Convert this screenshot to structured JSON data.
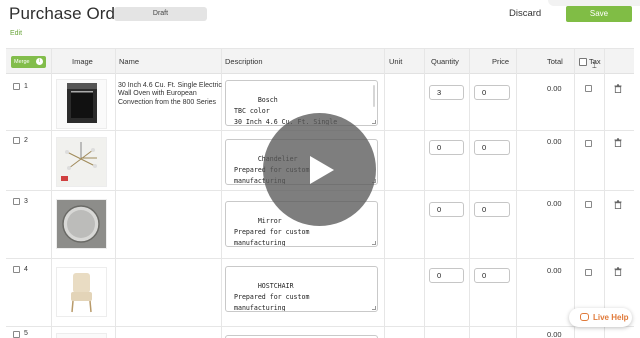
{
  "header": {
    "title": "Purchase Order",
    "status_badge": "Draft",
    "discard_label": "Discard",
    "save_label": "Save",
    "edit_label": "Edit"
  },
  "table": {
    "merge_label": "Merge",
    "merge_info": "i",
    "columns": {
      "image": "Image",
      "name": "Name",
      "description": "Description",
      "unit": "Unit",
      "quantity": "Quantity",
      "price": "Price",
      "total": "Total",
      "tax": "Tax"
    },
    "rows": [
      {
        "num": "1",
        "name": "30 Inch 4.6 Cu. Ft. Single Electric Wall Oven with European Convection from the 800 Series",
        "description": "Bosch\nTBC color\n30 Inch 4.6 Cu. Ft. Single",
        "quantity": "3",
        "price": "0",
        "total": "0.00",
        "image": "wall-oven"
      },
      {
        "num": "2",
        "name": "",
        "description": "Chandelier\nPrepared for custom\nmanufacturing",
        "quantity": "0",
        "price": "0",
        "total": "0.00",
        "image": "chandelier"
      },
      {
        "num": "3",
        "name": "",
        "description": "Mirror\nPrepared for custom\nmanufacturing",
        "quantity": "0",
        "price": "0",
        "total": "0.00",
        "image": "round-mirror"
      },
      {
        "num": "4",
        "name": "",
        "description": "HOSTCHAIR\nPrepared for custom\nmanufacturing",
        "quantity": "0",
        "price": "0",
        "total": "0.00",
        "image": "host-chair"
      },
      {
        "num": "5",
        "name": "",
        "description": "",
        "quantity": "",
        "price": "",
        "total": "0.00",
        "image": "partial-image"
      }
    ]
  },
  "live_help": {
    "label": "Live Help"
  },
  "icons": {
    "play": "play-icon",
    "trash": "trash-icon",
    "chat": "chat-bubble-icon"
  },
  "colors": {
    "accent_green": "#80bd45",
    "live_help_orange": "#e07a3a"
  }
}
